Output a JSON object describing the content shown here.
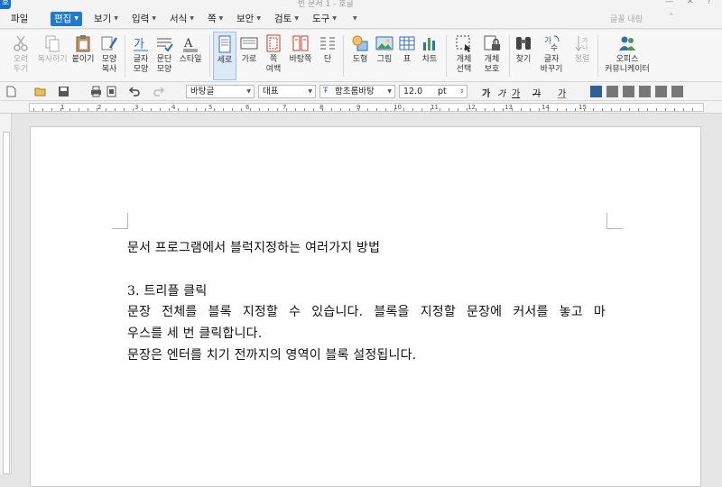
{
  "window": {
    "app_badge": "호",
    "title": "빈 문서 1 - 호글",
    "controls": "— ✕ ?"
  },
  "menu": {
    "file": "파일",
    "edit": "편집",
    "view": "보기",
    "insert": "입력",
    "format": "서식",
    "page": "쪽",
    "security": "보안",
    "review": "검토",
    "tools": "도구",
    "right_label": "글꼴 내림"
  },
  "ribbon": {
    "cut": [
      "오려",
      "두기"
    ],
    "copy": [
      "복사하기"
    ],
    "paste": [
      "붙이기"
    ],
    "format_copy": [
      "모양",
      "복사"
    ],
    "char_shape": [
      "글자",
      "모양"
    ],
    "para_shape": [
      "문단",
      "모양"
    ],
    "style": [
      "스타일"
    ],
    "vertical": [
      "세로"
    ],
    "horizontal": [
      "가로"
    ],
    "margin": [
      "쪽",
      "여백"
    ],
    "background": [
      "바탕쪽"
    ],
    "column": [
      "단"
    ],
    "shape": [
      "도형"
    ],
    "picture": [
      "그림"
    ],
    "table": [
      "표"
    ],
    "chart": [
      "차트"
    ],
    "object_select": [
      "개체",
      "선택"
    ],
    "object_protect": [
      "개체",
      "보호"
    ],
    "find": [
      "찾기"
    ],
    "replace": [
      "글자",
      "바꾸기"
    ],
    "align": [
      "정렬"
    ],
    "office_comm": [
      "오피스",
      "커뮤니케이터"
    ]
  },
  "formatting": {
    "style_value": "바탕글",
    "lang_value": "대표",
    "font_value": "함초롬바탕",
    "size_value": "12.0",
    "size_unit": "pt",
    "bold": "가",
    "italic": "가",
    "underline": "가",
    "strike": "가",
    "color": "가"
  },
  "ruler": {
    "numbers": [
      "1",
      "2",
      "3",
      "4",
      "5",
      "6",
      "7",
      "8",
      "9",
      "10",
      "11",
      "12",
      "13",
      "14",
      "15"
    ]
  },
  "document": {
    "lines": [
      "문서 프로그램에서 블럭지정하는 여러가지 방법",
      "",
      "3. 트리플 클릭",
      "문장 전체를 블록 지정할 수 있습니다. 블록을 지정할 문장에 커서를 놓고 마",
      "우스를 세 번 클릭합니다.",
      "문장은 엔터를 치기 전까지의 영역이 블록 설정됩니다."
    ]
  },
  "colors": {
    "accent": "#1c7ad2",
    "ribbon_selected": "#dde9f7"
  }
}
